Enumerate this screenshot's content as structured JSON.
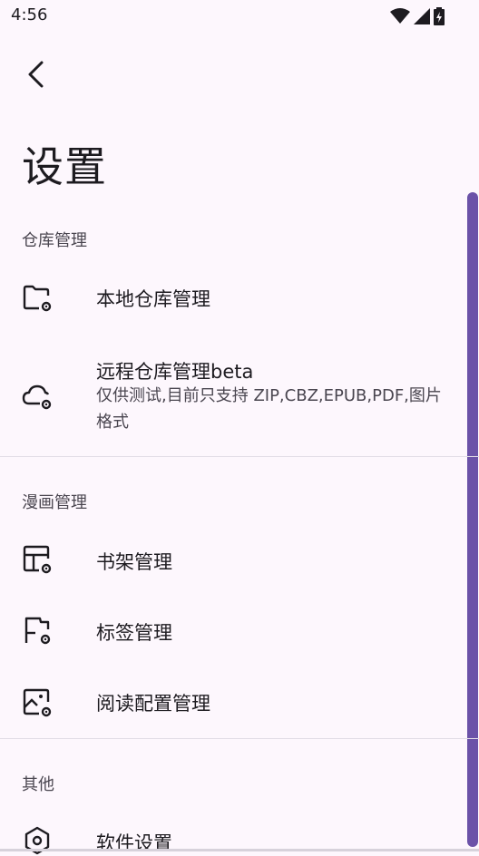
{
  "status_bar": {
    "time": "4:56"
  },
  "header": {
    "title": "设置"
  },
  "sections": [
    {
      "title": "仓库管理"
    },
    {
      "title": "漫画管理"
    },
    {
      "title": "其他"
    }
  ],
  "items": {
    "local_repo": {
      "label": "本地仓库管理",
      "icon": "folder-gear-icon"
    },
    "remote_repo": {
      "label": "远程仓库管理beta",
      "sub": "仅供测试,目前只支持 ZIP,CBZ,EPUB,PDF,图片 格式",
      "icon": "cloud-gear-icon"
    },
    "bookshelf": {
      "label": "书架管理",
      "icon": "table-gear-icon"
    },
    "tags": {
      "label": "标签管理",
      "icon": "flag-gear-icon"
    },
    "reader_config": {
      "label": "阅读配置管理",
      "icon": "image-gear-icon"
    },
    "software": {
      "label": "软件设置",
      "icon": "settings-icon"
    }
  },
  "colors": {
    "background": "#fdf7fd",
    "scrollbar": "#6b52a8"
  }
}
